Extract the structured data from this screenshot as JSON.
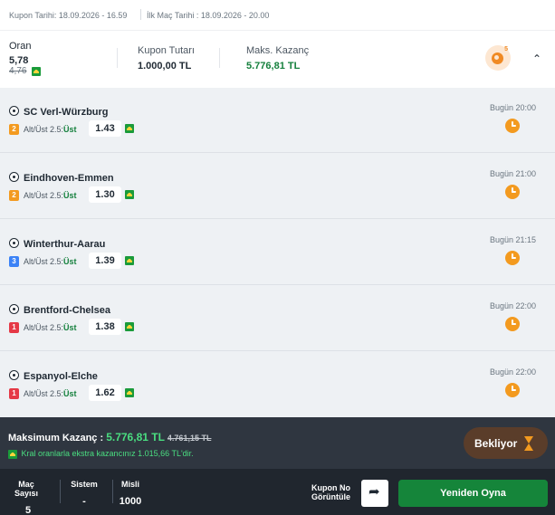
{
  "topbar": {
    "kupon_tarihi": "Kupon Tarihi: 18.09.2026 - 16.59",
    "ilk_mac_tarihi": "İlk Maç Tarihi : 18.09.2026 - 20.00"
  },
  "summary": {
    "oran_label": "Oran",
    "oran_value": "5,78",
    "oran_old": "4,76",
    "kupon_tutari_label": "Kupon Tutarı",
    "kupon_tutari_value": "1.000,00 TL",
    "maks_kazanc_label": "Maks. Kazanç",
    "maks_kazanc_value": "5.776,81 TL",
    "share_badge": "5",
    "collapse_icon": "chevron-up-icon"
  },
  "matches": [
    {
      "name": "SC Verl-Würzburg",
      "num": "2",
      "num_color": "orange",
      "market": "Alt/Üst 2.5:",
      "pick": "Üst",
      "odd": "1.43",
      "time": "Bugün 20:00"
    },
    {
      "name": "Eindhoven-Emmen",
      "num": "2",
      "num_color": "orange",
      "market": "Alt/Üst 2.5:",
      "pick": "Üst",
      "odd": "1.30",
      "time": "Bugün 21:00"
    },
    {
      "name": "Winterthur-Aarau",
      "num": "3",
      "num_color": "blue",
      "market": "Alt/Üst 2.5:",
      "pick": "Üst",
      "odd": "1.39",
      "time": "Bugün 21:15"
    },
    {
      "name": "Brentford-Chelsea",
      "num": "1",
      "num_color": "red",
      "market": "Alt/Üst 2.5:",
      "pick": "Üst",
      "odd": "1.38",
      "time": "Bugün 22:00"
    },
    {
      "name": "Espanyol-Elche",
      "num": "1",
      "num_color": "red",
      "market": "Alt/Üst 2.5:",
      "pick": "Üst",
      "odd": "1.62",
      "time": "Bugün 22:00"
    }
  ],
  "footer": {
    "max_label": "Maksimum Kazanç : ",
    "max_value": "5.776,81 TL",
    "max_old": "4.761,15 TL",
    "kral_text": "Kral oranlarla ekstra kazancınız 1.015,66 TL'dir.",
    "status_label": "Bekliyor",
    "mac_sayisi_label": "Maç Sayısı",
    "mac_sayisi_value": "5",
    "sistem_label": "Sistem",
    "sistem_value": "-",
    "misli_label": "Misli",
    "misli_value": "1000",
    "kupon_no_label_1": "Kupon No",
    "kupon_no_label_2": "Görüntüle",
    "replay_label": "Yeniden Oyna"
  },
  "colors": {
    "accent_green": "#15853a",
    "odds_green": "#4ade80",
    "orange": "#f39a1f",
    "dark_bg": "#2f3640"
  }
}
